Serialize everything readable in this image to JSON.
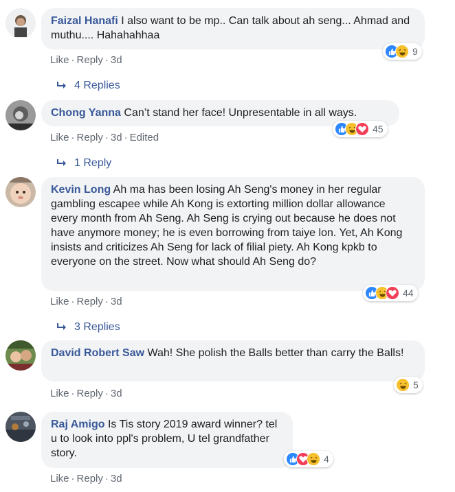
{
  "comments": [
    {
      "author": "Faizal Hanafi",
      "text": "I also want to be mp.. Can talk about ah seng... Ahmad and muthu.... Hahahahhaa",
      "actions": {
        "like": "Like",
        "reply": "Reply",
        "time": "3d",
        "edited": ""
      },
      "reactions": {
        "icons": [
          "like-icon",
          "haha-icon"
        ],
        "count": "9"
      },
      "replies_label": "4 Replies"
    },
    {
      "author": "Chong Yanna",
      "text": "Can’t stand her face! Unpresentable in all ways.",
      "actions": {
        "like": "Like",
        "reply": "Reply",
        "time": "3d",
        "edited": "Edited"
      },
      "reactions": {
        "icons": [
          "like-icon",
          "haha-icon",
          "love-icon"
        ],
        "count": "45"
      },
      "replies_label": "1 Reply"
    },
    {
      "author": "Kevin Long",
      "text": "Ah ma has been losing Ah Seng's money in her regular gambling escapee while Ah Kong is extorting million dollar allowance every month from Ah Seng. Ah Seng is crying out because he does not have anymore money; he is even borrowing from taiye lon. Yet, Ah Kong insists and criticizes Ah Seng for lack of filial piety. Ah Kong kpkb to everyone on the street. Now what should Ah Seng do?",
      "actions": {
        "like": "Like",
        "reply": "Reply",
        "time": "3d",
        "edited": ""
      },
      "reactions": {
        "icons": [
          "like-icon",
          "haha-icon",
          "love-icon"
        ],
        "count": "44"
      },
      "replies_label": "3 Replies"
    },
    {
      "author": "David Robert Saw",
      "text": "Wah! She polish the Balls better than carry the Balls!",
      "actions": {
        "like": "Like",
        "reply": "Reply",
        "time": "3d",
        "edited": ""
      },
      "reactions": {
        "icons": [
          "haha-icon"
        ],
        "count": "5"
      },
      "replies_label": ""
    },
    {
      "author": "Raj Amigo",
      "text": "Is Tis story 2019 award winner? tel u to look into ppl's problem, U tel grandfather story.",
      "actions": {
        "like": "Like",
        "reply": "Reply",
        "time": "3d",
        "edited": ""
      },
      "reactions": {
        "icons": [
          "like-icon",
          "love-icon",
          "haha-icon"
        ],
        "count": "4"
      },
      "replies_label": ""
    }
  ],
  "colors": {
    "author": "#385898",
    "bubble": "#f2f3f5",
    "meta": "#606770",
    "like": "#2d88ff",
    "haha": "#f7c02d",
    "love": "#f33e58"
  }
}
